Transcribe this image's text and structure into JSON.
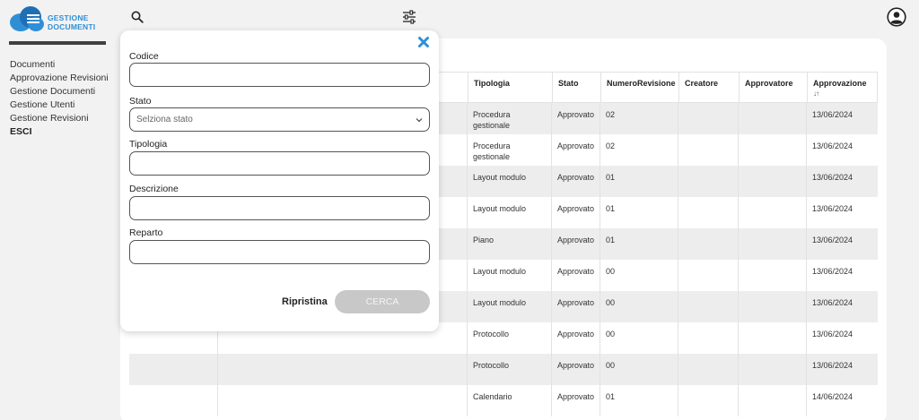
{
  "app": {
    "logo_line1": "GESTIONE",
    "logo_line2": "DOCUMENTI",
    "brand_color": "#2f8fd6"
  },
  "topbar": {
    "search_icon": "search-icon",
    "filter_icon": "sliders-icon",
    "account_icon": "user-circle-icon"
  },
  "sidebar": {
    "items": [
      {
        "label": "Documenti"
      },
      {
        "label": "Approvazione Revisioni"
      },
      {
        "label": "Gestione Documenti"
      },
      {
        "label": "Gestione Utenti"
      },
      {
        "label": "Gestione Revisioni"
      },
      {
        "label": "ESCI"
      }
    ]
  },
  "filter_panel": {
    "fields": [
      {
        "label": "Codice",
        "value": ""
      },
      {
        "label": "Stato",
        "value": "Selziona stato"
      },
      {
        "label": "Tipologia",
        "value": ""
      },
      {
        "label": "Descrizione",
        "value": ""
      },
      {
        "label": "Reparto",
        "value": ""
      }
    ],
    "reset_label": "Ripristina",
    "search_label": "CERCA"
  },
  "table": {
    "columns": [
      "Tipologia",
      "Stato",
      "NumeroRevisione",
      "Creatore",
      "Approvatore",
      "Approvazione"
    ],
    "sort_indicator": "↓↑",
    "rows": [
      {
        "tipologia": "Procedura gestionale",
        "stato": "Approvato",
        "revisione": "02",
        "creatore": "",
        "approvatore": "",
        "approvazione": "13/06/2024"
      },
      {
        "tipologia": "Procedura gestionale",
        "stato": "Approvato",
        "revisione": "02",
        "creatore": "",
        "approvatore": "",
        "approvazione": "13/06/2024"
      },
      {
        "tipologia": "Layout modulo",
        "stato": "Approvato",
        "revisione": "01",
        "creatore": "",
        "approvatore": "",
        "approvazione": "13/06/2024"
      },
      {
        "tipologia": "Layout modulo",
        "stato": "Approvato",
        "revisione": "01",
        "creatore": "",
        "approvatore": "",
        "approvazione": "13/06/2024"
      },
      {
        "tipologia": "Piano",
        "stato": "Approvato",
        "revisione": "01",
        "creatore": "",
        "approvatore": "",
        "approvazione": "13/06/2024"
      },
      {
        "tipologia": "Layout modulo",
        "stato": "Approvato",
        "revisione": "00",
        "creatore": "",
        "approvatore": "",
        "approvazione": "13/06/2024"
      },
      {
        "tipologia": "Layout modulo",
        "stato": "Approvato",
        "revisione": "00",
        "creatore": "",
        "approvatore": "",
        "approvazione": "13/06/2024"
      },
      {
        "tipologia": "Protocollo",
        "stato": "Approvato",
        "revisione": "00",
        "creatore": "",
        "approvatore": "",
        "approvazione": "13/06/2024"
      },
      {
        "tipologia": "Protocollo",
        "stato": "Approvato",
        "revisione": "00",
        "creatore": "",
        "approvatore": "",
        "approvazione": "13/06/2024"
      },
      {
        "tipologia": "Calendario",
        "stato": "Approvato",
        "revisione": "01",
        "creatore": "",
        "approvatore": "",
        "approvazione": "14/06/2024"
      }
    ]
  }
}
